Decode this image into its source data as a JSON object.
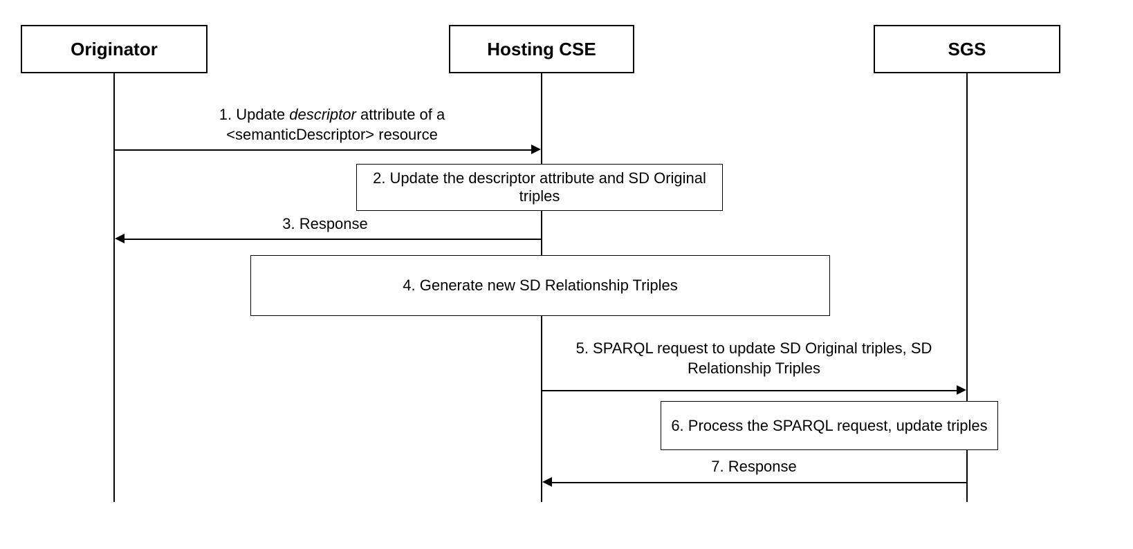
{
  "participants": {
    "originator": "Originator",
    "hostingCse": "Hosting CSE",
    "sgs": "SGS"
  },
  "messages": {
    "m1_pre": "1. Update ",
    "m1_italic": "descriptor",
    "m1_post": " attribute of a",
    "m1_line2": "<semanticDescriptor> resource",
    "m2": "2. Update the descriptor attribute and SD Original triples",
    "m3": "3. Response",
    "m4": "4. Generate new SD Relationship Triples",
    "m5": "5. SPARQL request to update SD Original triples, SD Relationship Triples",
    "m6": "6. Process the SPARQL request, update triples",
    "m7": "7. Response"
  }
}
